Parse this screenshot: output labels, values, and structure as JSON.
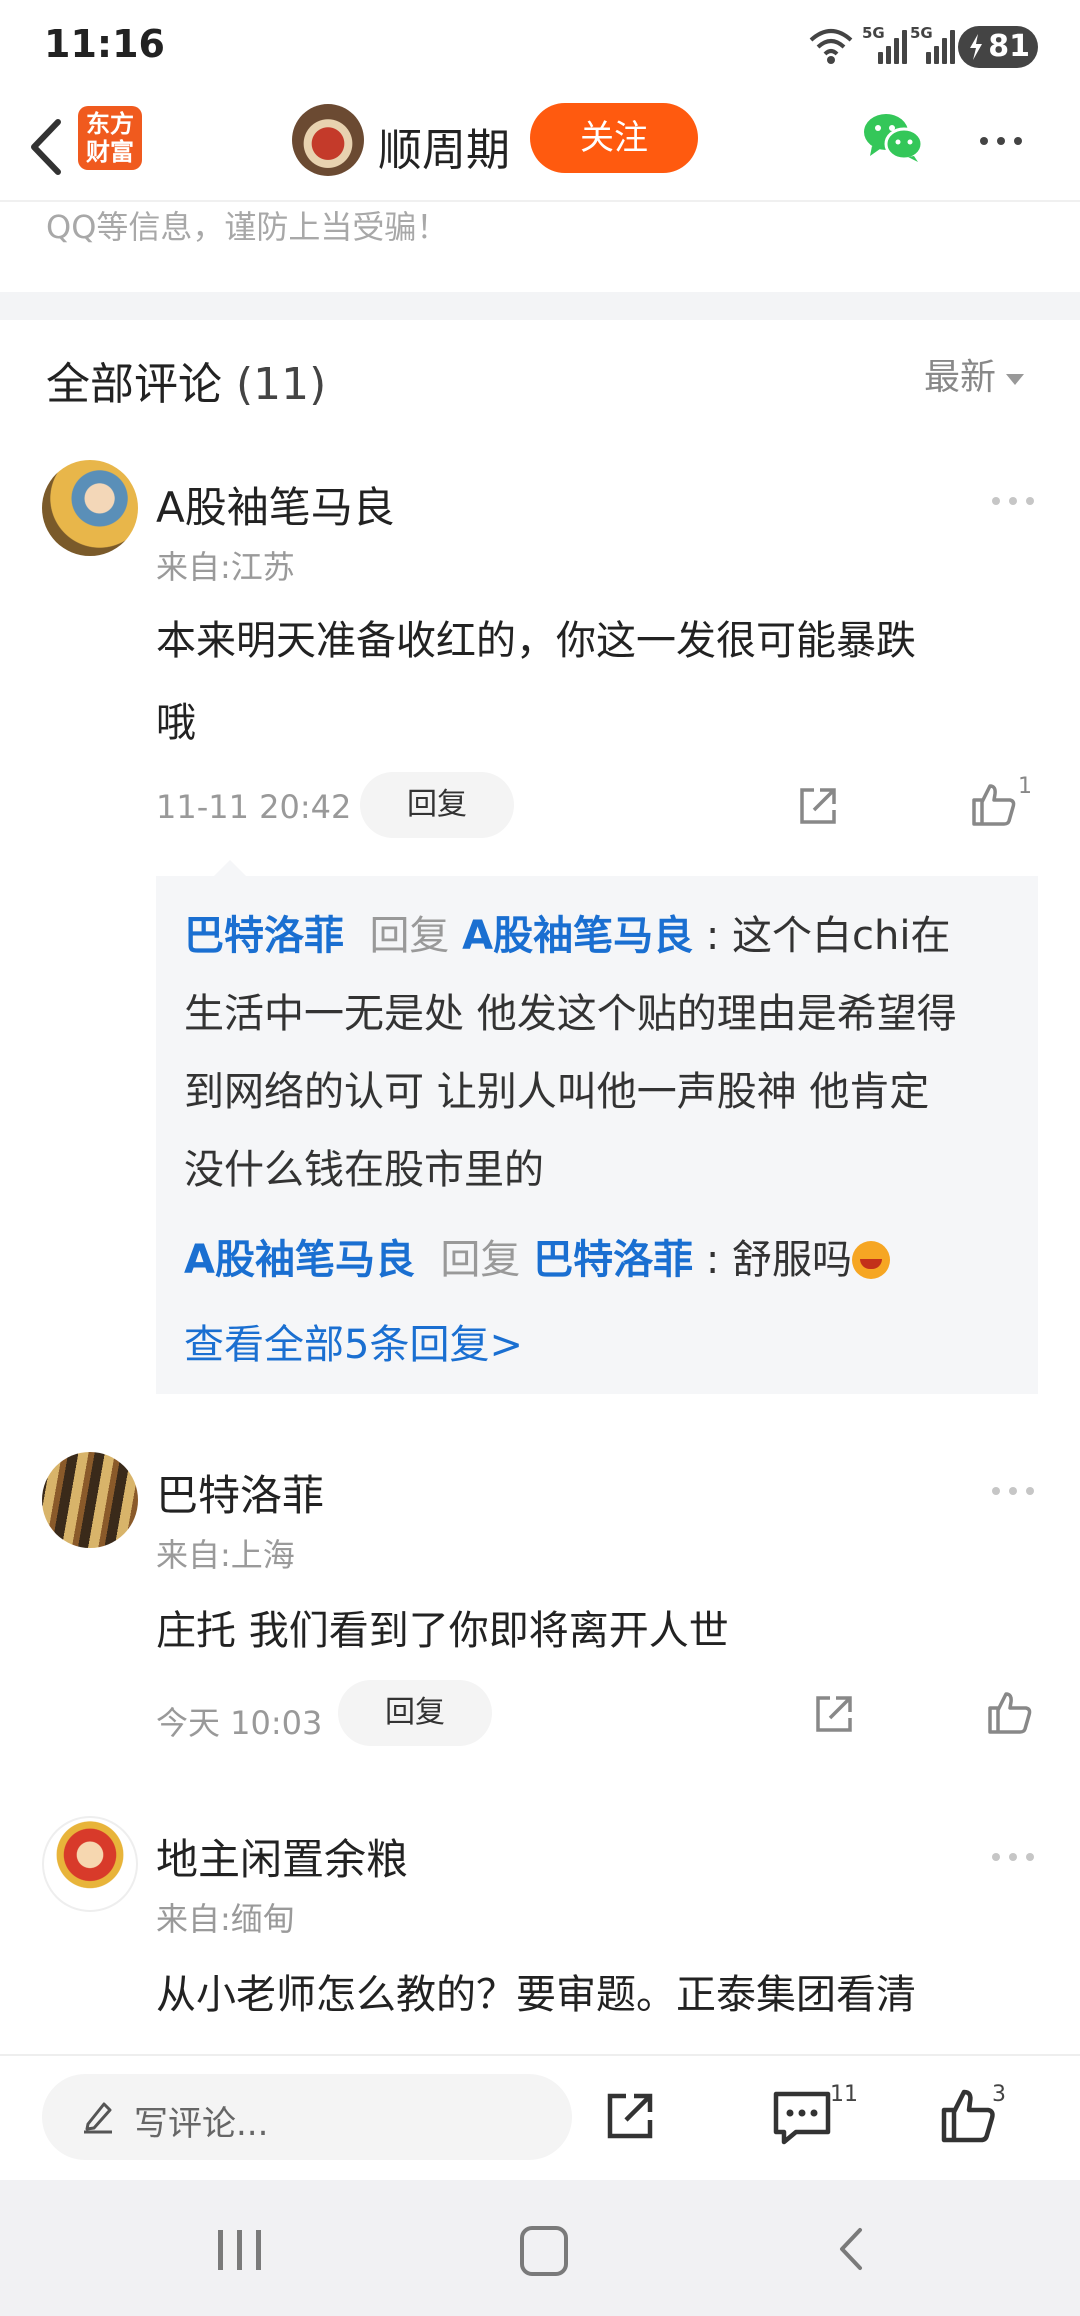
{
  "status_bar": {
    "time": "11:16",
    "battery": "81",
    "net1": "5G",
    "net2": "5G"
  },
  "header": {
    "app_logo": "东方财富",
    "author_name": "顺周期",
    "follow_label": "关注",
    "icons": [
      "back-icon",
      "wechat-icon",
      "more-icon"
    ]
  },
  "notice": "QQ等信息，谨防上当受骗！",
  "comments_header": {
    "title": "全部评论",
    "count": "(11)",
    "sort": "最新"
  },
  "comments": [
    {
      "name": "A股袖笔马良",
      "location": "来自:江苏",
      "text_line1": "本来明天准备收红的，你这一发很可能暴跌",
      "text_line2": "哦",
      "time": "11-11 20:42",
      "reply_label": "回复",
      "likes": "1"
    },
    {
      "name": "巴特洛菲",
      "location": "来自:上海",
      "text_line1": "庄托 我们看到了你即将离开人世",
      "time": "今天 10:03",
      "reply_label": "回复",
      "likes": ""
    },
    {
      "name": "地主闲置余粮",
      "location": "来自:缅甸",
      "text_line1": "从小老师怎么教的？要审题。正泰集团看清"
    }
  ],
  "replies": [
    {
      "from": "巴特洛菲",
      "word": "回复",
      "to": "A股袖笔马良",
      "sep": " : ",
      "line1": "这个白chi在",
      "line2": "生活中一无是处 他发这个贴的理由是希望得",
      "line3": "到网络的认可 让别人叫他一声股神 他肯定",
      "line4": "没什么钱在股市里的"
    },
    {
      "from": "A股袖笔马良",
      "word": "回复",
      "to": "巴特洛菲",
      "sep": " : ",
      "line1": "舒服吗"
    }
  ],
  "view_all": "查看全部5条回复>",
  "bottom_bar": {
    "placeholder": "写评论...",
    "comment_count": "11",
    "like_count": "3"
  },
  "colors": {
    "accent": "#ff5a0f",
    "link": "#1a6fd1",
    "wechat": "#34c759"
  }
}
